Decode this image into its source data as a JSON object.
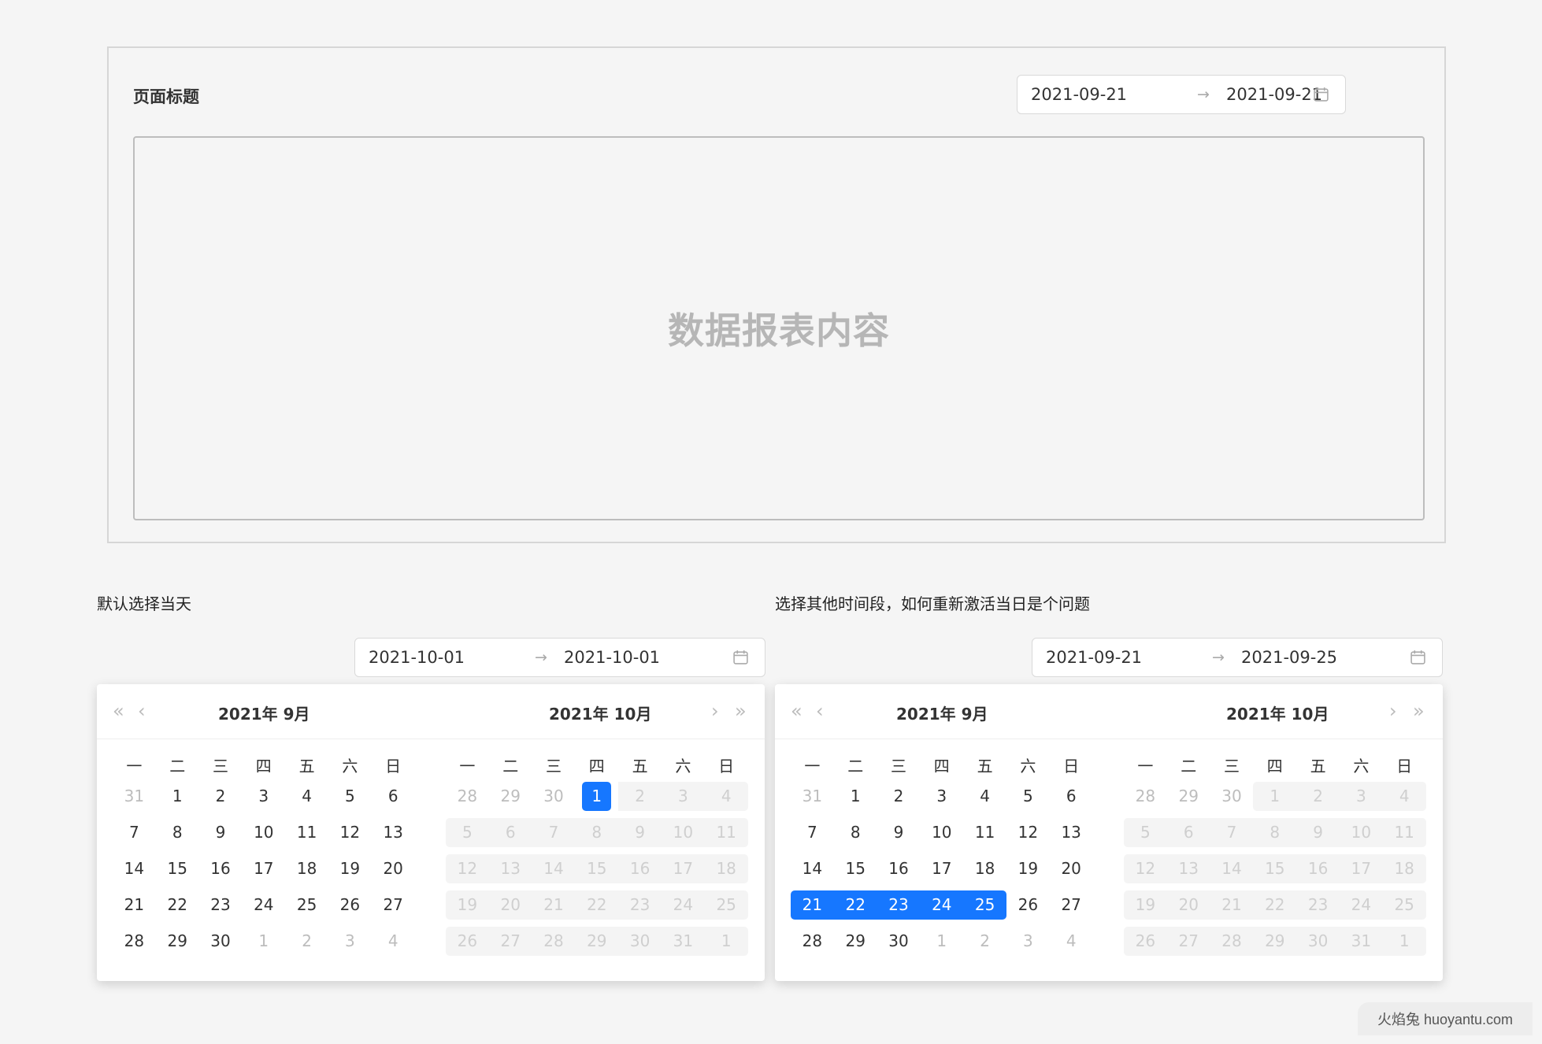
{
  "card": {
    "title": "页面标题",
    "content_placeholder": "数据报表内容",
    "range": {
      "start": "2021-09-21",
      "arrow": "→",
      "end": "2021-09-21"
    }
  },
  "left": {
    "caption": "默认选择当天",
    "range": {
      "start": "2021-10-01",
      "arrow": "→",
      "end": "2021-10-01"
    },
    "month1_title": "2021年 9月",
    "month2_title": "2021年 10月"
  },
  "right": {
    "caption": "选择其他时间段，如何重新激活当日是个问题",
    "range": {
      "start": "2021-09-21",
      "arrow": "→",
      "end": "2021-09-25"
    },
    "month1_title": "2021年 9月",
    "month2_title": "2021年 10月"
  },
  "nav": {
    "prev_year": "«",
    "prev_month": "‹",
    "next_month": "›",
    "next_year": "»"
  },
  "weekdays": [
    "一",
    "二",
    "三",
    "四",
    "五",
    "六",
    "日"
  ],
  "calendar_sept": [
    [
      "31",
      "1",
      "2",
      "3",
      "4",
      "5",
      "6"
    ],
    [
      "7",
      "8",
      "9",
      "10",
      "11",
      "12",
      "13"
    ],
    [
      "14",
      "15",
      "16",
      "17",
      "18",
      "19",
      "20"
    ],
    [
      "21",
      "22",
      "23",
      "24",
      "25",
      "26",
      "27"
    ],
    [
      "28",
      "29",
      "30",
      "1",
      "2",
      "3",
      "4"
    ]
  ],
  "calendar_oct": [
    [
      "28",
      "29",
      "30",
      "1",
      "2",
      "3",
      "4"
    ],
    [
      "5",
      "6",
      "7",
      "8",
      "9",
      "10",
      "11"
    ],
    [
      "12",
      "13",
      "14",
      "15",
      "16",
      "17",
      "18"
    ],
    [
      "19",
      "20",
      "21",
      "22",
      "23",
      "24",
      "25"
    ],
    [
      "26",
      "27",
      "28",
      "29",
      "30",
      "31",
      "1"
    ]
  ],
  "watermark": "火焰兔 huoyantu.com",
  "colors": {
    "accent": "#1677ff",
    "muted": "#bdbdbd",
    "disabled_bg": "#f4f4f4"
  }
}
